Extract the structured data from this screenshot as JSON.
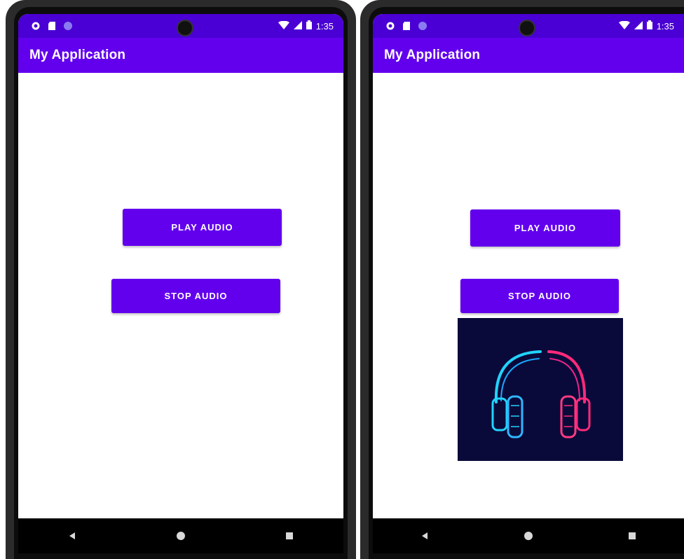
{
  "status_bar": {
    "time": "1:35",
    "bg": "#4a00d4"
  },
  "app_bar": {
    "title": "My Application",
    "bg": "#6200ee"
  },
  "buttons": {
    "play_label": "PLAY AUDIO",
    "stop_label": "STOP AUDIO",
    "bg": "#6200ee"
  },
  "nav": {
    "back_icon": "back-triangle-icon",
    "home_icon": "home-circle-icon",
    "recents_icon": "recents-square-icon"
  },
  "image": {
    "description_icon": "headphones-icon",
    "bg": "#0a0a3a",
    "left_color": "#22d3ff",
    "right_color": "#ff2a7a"
  }
}
